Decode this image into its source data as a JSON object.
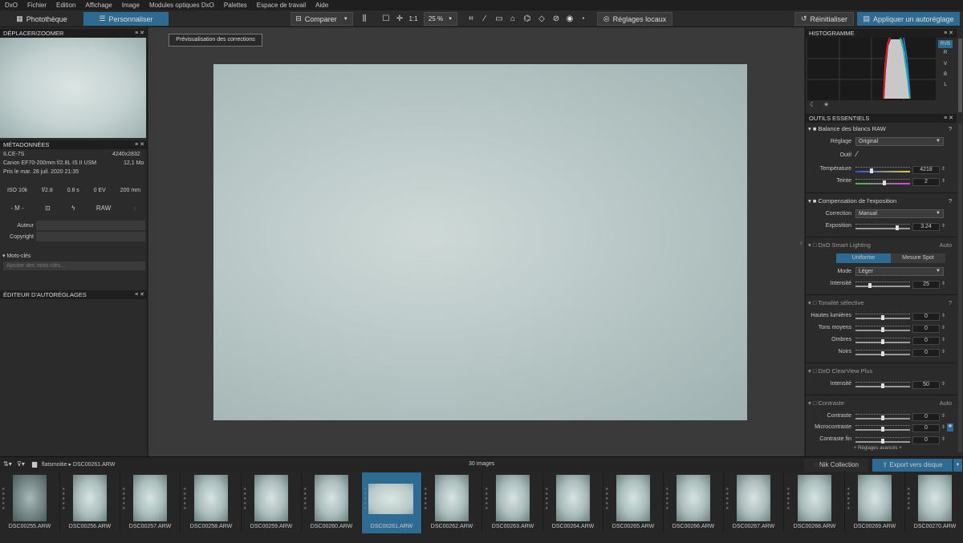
{
  "menu": [
    "DxO",
    "Fichier",
    "Edition",
    "Affichage",
    "Image",
    "Modules optiques DxO",
    "Palettes",
    "Espace de travail",
    "Aide"
  ],
  "tabs": {
    "library": "Photothèque",
    "customize": "Personnaliser"
  },
  "toolbar": {
    "compare": "Comparer",
    "zoom_ratio": "1:1",
    "zoom": "25 %",
    "local_adjust": "Réglages locaux",
    "reset": "Réinitialiser",
    "apply_preset": "Appliquer un autoréglage"
  },
  "preview_label": "Prévisualisation des corrections",
  "left": {
    "move_zoom": "DÉPLACER/ZOOMER",
    "metadata": "MÉTADONNÉES",
    "camera": "ILCE-7S",
    "date_short": "4240x2832",
    "lens": "Canon EF70-200mm f/2.8L IS II USM",
    "size": "12,1 Mo",
    "taken": "Pris le mar. 28 juil. 2020 21:35",
    "exif": [
      "ISO 10k",
      "f/2.8",
      "0.8 s",
      "0 EV",
      "200 mm"
    ],
    "exif2": [
      "- M -",
      "",
      "",
      "RAW",
      ""
    ],
    "author_label": "Auteur",
    "copyright_label": "Copyright",
    "keywords": "Mots-clés",
    "keywords_placeholder": "Ajouter des mots-clés...",
    "preset_editor": "ÉDITEUR D'AUTORÉGLAGES"
  },
  "right": {
    "histogram": "HISTOGRAMME",
    "hist_channels": [
      "RVB",
      "R",
      "V",
      "B",
      "L"
    ],
    "essential": "OUTILS ESSENTIELS",
    "wb": {
      "title": "Balance des blancs RAW",
      "preset_label": "Réglage",
      "preset": "Original",
      "tool_label": "Outil",
      "temp_label": "Température",
      "temp": "4218",
      "tint_label": "Teinte",
      "tint": "2"
    },
    "exposure": {
      "title": "Compensation de l'exposition",
      "corr_label": "Correction",
      "corr": "Manual",
      "exp_label": "Exposition",
      "exp": "3.24"
    },
    "smart": {
      "title": "DxO Smart Lighting",
      "auto": "Auto",
      "uniform": "Uniforme",
      "spot": "Mesure Spot",
      "mode_label": "Mode",
      "mode": "Léger",
      "int_label": "Intensité",
      "int": "25"
    },
    "tonal": {
      "title": "Tonalité sélective",
      "rows": [
        {
          "label": "Hautes lumières",
          "v": "0"
        },
        {
          "label": "Tons moyens",
          "v": "0"
        },
        {
          "label": "Ombres",
          "v": "0"
        },
        {
          "label": "Noirs",
          "v": "0"
        }
      ]
    },
    "clearview": {
      "title": "DxO ClearView Plus",
      "int_label": "Intensité",
      "int": "50"
    },
    "contrast": {
      "title": "Contraste",
      "auto": "Auto",
      "rows": [
        {
          "label": "Contraste",
          "v": "0"
        },
        {
          "label": "Microcontraste",
          "v": "0"
        },
        {
          "label": "Contraste fin",
          "v": "0"
        }
      ],
      "more": "+ Réglages avancés +"
    }
  },
  "filmbar": {
    "folder": "flatsmoitie",
    "file": "DSC00261.ARW",
    "count": "30 images",
    "nik": "Nik Collection",
    "export": "Export vers disque"
  },
  "thumbs": [
    "DSC00255.ARW",
    "DSC00256.ARW",
    "DSC00257.ARW",
    "DSC00258.ARW",
    "DSC00259.ARW",
    "DSC00260.ARW",
    "DSC00261.ARW",
    "DSC00262.ARW",
    "DSC00263.ARW",
    "DSC00264.ARW",
    "DSC00265.ARW",
    "DSC00266.ARW",
    "DSC00267.ARW",
    "DSC00268.ARW",
    "DSC00269.ARW",
    "DSC00270.ARW"
  ],
  "selected_thumb": 6
}
